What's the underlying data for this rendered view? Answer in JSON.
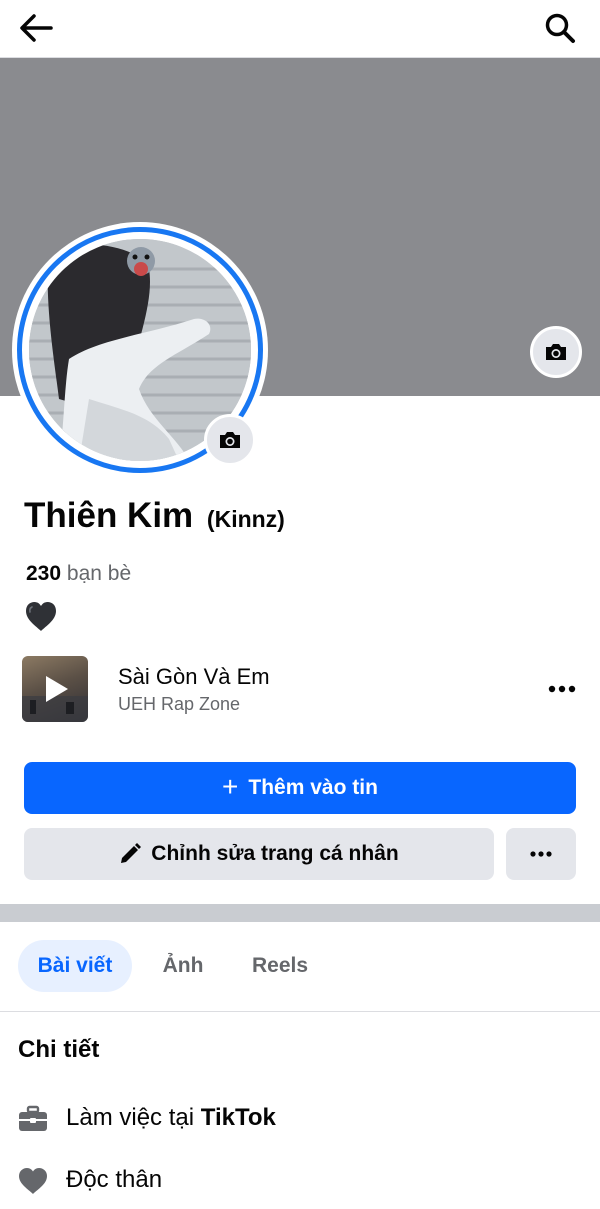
{
  "topbar": {
    "back_icon": "arrow-left-icon",
    "search_icon": "search-icon"
  },
  "profile": {
    "name": "Thiên Kim",
    "alternate_name": "(Kinnz)",
    "friend_count": "230",
    "friend_label": "bạn bè",
    "bio_emoji": "black-heart"
  },
  "music": {
    "title": "Sài Gòn Và Em",
    "artist": "UEH Rap Zone"
  },
  "actions": {
    "add_story": "Thêm vào tin",
    "edit_profile": "Chỉnh sửa trang cá nhân"
  },
  "tabs": [
    {
      "label": "Bài viết",
      "active": true
    },
    {
      "label": "Ảnh",
      "active": false
    },
    {
      "label": "Reels",
      "active": false
    }
  ],
  "details": {
    "title": "Chi tiết",
    "work_prefix": "Làm việc tại",
    "work_place": "TikTok",
    "relationship": "Độc thân"
  },
  "colors": {
    "accent": "#0866ff",
    "ring": "#1877f2",
    "cover": "#8a8b8f",
    "button_gray": "#e4e6eb"
  }
}
